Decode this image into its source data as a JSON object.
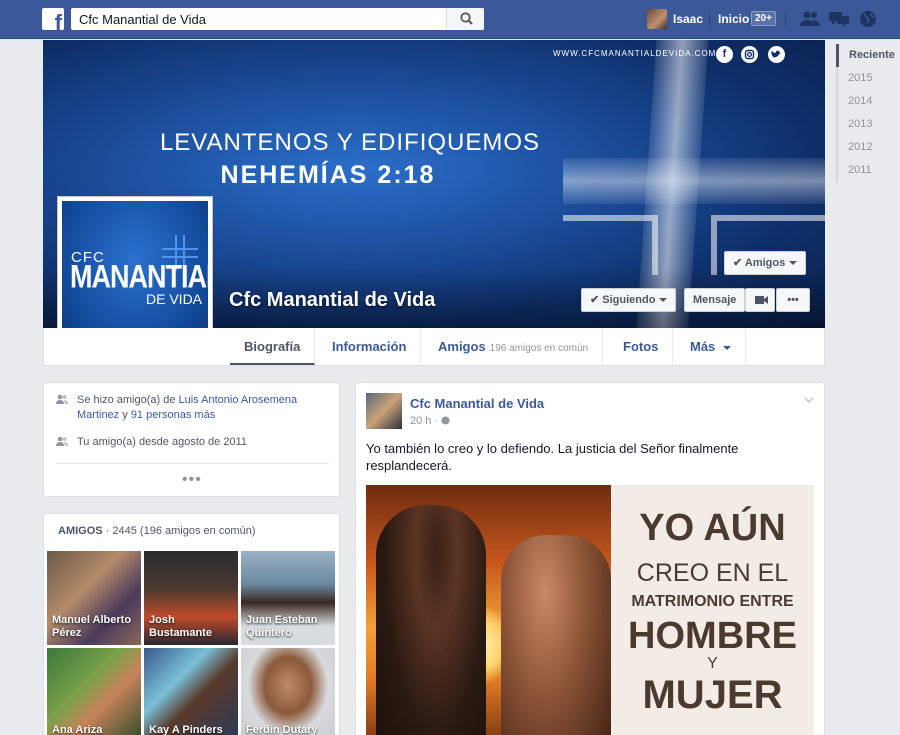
{
  "topbar": {
    "search_value": "Cfc Manantial de Vida",
    "user_name": "Isaac",
    "home_label": "Inicio",
    "home_badge": "20+"
  },
  "cover": {
    "url_text": "WWW.CFCMANANTIALDEVIDA.COM",
    "line1": "LEVANTENOS Y EDIFIQUEMOS",
    "line2": "NEHEMÍAS 2:18",
    "page_name": "Cfc Manantial de Vida",
    "social": [
      "facebook-icon",
      "instagram-icon",
      "twitter-icon"
    ],
    "profile_cfc": "CFC",
    "profile_manantial": "MANANTIAL",
    "profile_devida": "DE VIDA"
  },
  "actions": {
    "amigos": "Amigos",
    "siguiendo": "Siguiendo",
    "mensaje": "Mensaje",
    "more": "•••"
  },
  "tabs": {
    "biografia": "Biografía",
    "informacion": "Información",
    "amigos": "Amigos",
    "amigos_sub": "196 amigos en común",
    "fotos": "Fotos",
    "mas": "Más"
  },
  "years": [
    "Reciente",
    "2015",
    "2014",
    "2013",
    "2012",
    "2011"
  ],
  "friendship": {
    "line1_prefix": "Se hizo amigo(a) de",
    "line1_person": "Luis Antonio Arosemena Martinez",
    "line1_and": "y",
    "line1_more": "91 personas más",
    "line2": "Tu amigo(a) desde agosto de 2011",
    "dots": "•••"
  },
  "friends": {
    "title": "AMIGOS",
    "count": "· 2445 (196 amigos en común)",
    "tiles": [
      "Manuel Alberto Pérez",
      "Josh Bustamante",
      "Juan Esteban Quintero",
      "Ana Ariza",
      "Kay A Pinders",
      "Ferdin Dutary"
    ]
  },
  "post": {
    "author": "Cfc Manantial de Vida",
    "time": "20 h ·",
    "text": "Yo también lo creo y lo defiendo. La justicia del Señor finalmente resplandecerá.",
    "image_lines": [
      "YO AÚN",
      "CREO EN EL",
      "MATRIMONIO ENTRE",
      "HOMBRE",
      "Y",
      "MUJER"
    ]
  },
  "colors": {
    "brand": "#3b5998",
    "cover_blue": "#1d4f9e"
  }
}
